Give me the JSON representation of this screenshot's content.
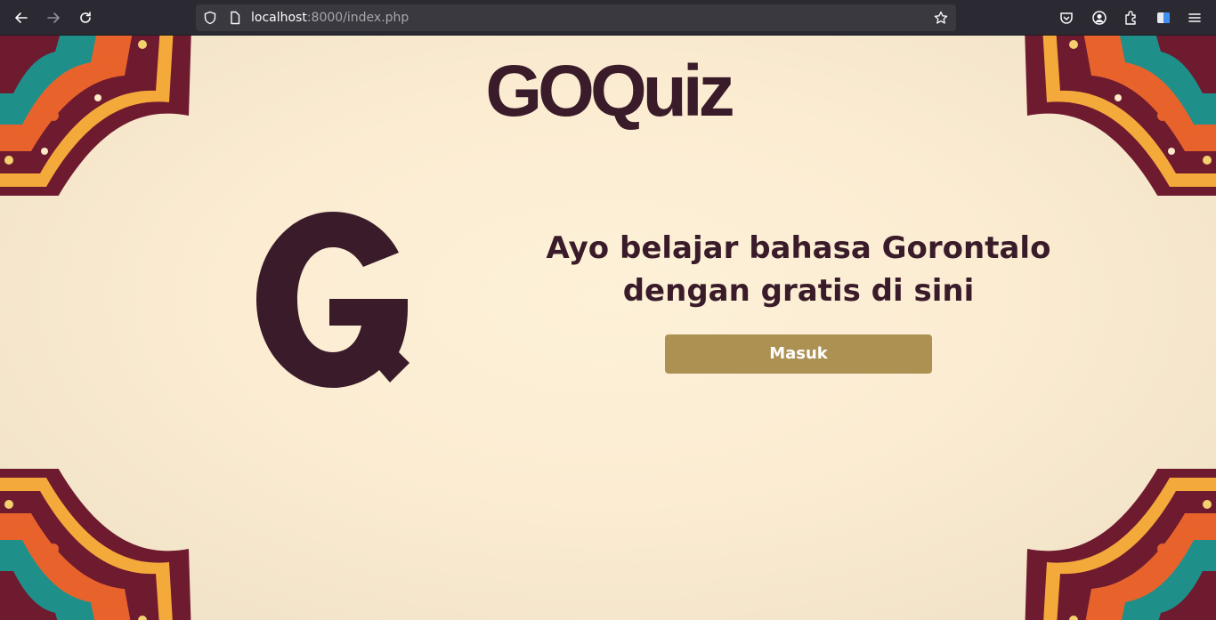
{
  "browser": {
    "url_host": "localhost",
    "url_path": ":8000/index.php"
  },
  "page": {
    "brand": "GOQuiz",
    "headline": "Ayo belajar bahasa Gorontalo dengan gratis di sini",
    "login_label": "Masuk"
  },
  "colors": {
    "brand_dark": "#3a1b29",
    "button_gold": "#ad9152",
    "background_cream": "#fbecd2"
  },
  "icons": [
    "back-arrow-icon",
    "forward-arrow-icon",
    "reload-icon",
    "shield-icon",
    "page-icon",
    "star-icon",
    "pocket-icon",
    "account-icon",
    "extensions-icon",
    "container-icon",
    "menu-icon"
  ]
}
